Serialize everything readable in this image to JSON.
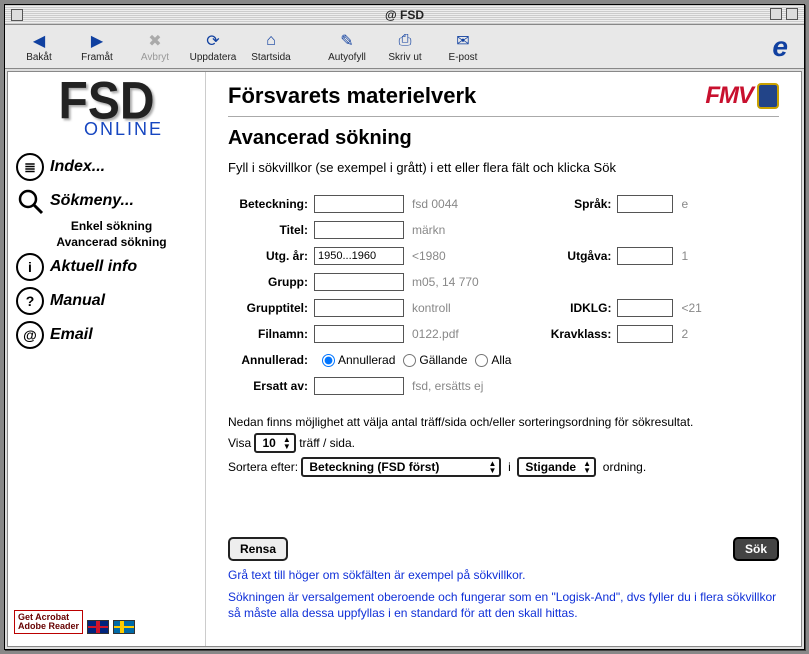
{
  "window": {
    "title": "@ FSD"
  },
  "toolbar": {
    "back": "Bakåt",
    "forward": "Framåt",
    "stop": "Avbryt",
    "refresh": "Uppdatera",
    "home": "Startsida",
    "autofill": "Autyofyll",
    "print": "Skriv ut",
    "mail": "E-post"
  },
  "sidebar": {
    "logo_main": "FSD",
    "logo_sub": "ONLINE",
    "items": [
      {
        "label": "Index..."
      },
      {
        "label": "Sökmeny..."
      },
      {
        "label": "Aktuell info"
      },
      {
        "label": "Manual"
      },
      {
        "label": "Email"
      }
    ],
    "sub1": "Enkel sökning",
    "sub2": "Avancerad sökning",
    "acrobat_line1": "Get Acrobat",
    "acrobat_line2": "Adobe Reader"
  },
  "main": {
    "org_title": "Försvarets materielverk",
    "fmv": "FMV",
    "page_title": "Avancerad sökning",
    "instruction": "Fyll i sökvillkor (se exempel i grått) i ett eller flera fält och klicka Sök",
    "fields_left": {
      "beteckning": {
        "label": "Beteckning:",
        "hint": "fsd 0044"
      },
      "titel": {
        "label": "Titel:",
        "hint": "märkn"
      },
      "utg_ar": {
        "label": "Utg. år:",
        "value": "1950...1960",
        "hint": "<1980"
      },
      "grupp": {
        "label": "Grupp:",
        "hint": "m05, 14 770"
      },
      "grupptitel": {
        "label": "Grupptitel:",
        "hint": "kontroll"
      },
      "filnamn": {
        "label": "Filnamn:",
        "hint": "0122.pdf"
      },
      "annullerad": {
        "label": "Annullerad:",
        "opt1": "Annullerad",
        "opt2": "Gällande",
        "opt3": "Alla"
      },
      "ersatt": {
        "label": "Ersatt av:",
        "hint": "fsd, ersätts ej"
      }
    },
    "fields_right": {
      "sprak": {
        "label": "Språk:",
        "hint": "e"
      },
      "utgava": {
        "label": "Utgåva:",
        "hint": "1"
      },
      "idklg": {
        "label": "IDKLG:",
        "hint": "<21"
      },
      "kravklass": {
        "label": "Kravklass:",
        "hint": "2"
      }
    },
    "below_text": "Nedan finns möjlighet att välja antal träff/sida och/eller sorteringsordning för sökresultat.",
    "visa_label": "Visa",
    "per_page": "10",
    "per_page_suffix": "träff / sida.",
    "sort_label": "Sortera efter:",
    "sort_field": "Beteckning (FSD först)",
    "sort_conj": "i",
    "sort_dir": "Stigande",
    "sort_suffix": "ordning.",
    "rensa": "Rensa",
    "sok": "Sök",
    "note1": "Grå text till höger om sökfälten är exempel på sökvillkor.",
    "note2": "Sökningen är versalgement oberoende och fungerar som en \"Logisk-And\", dvs fyller du i flera sökvillkor så måste alla dessa uppfyllas i en standard för att den skall hittas."
  }
}
